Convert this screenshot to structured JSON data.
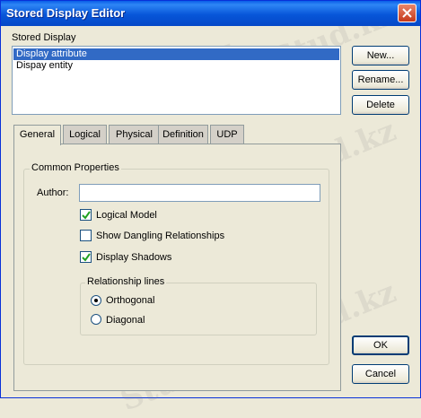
{
  "window": {
    "title": "Stored Display Editor"
  },
  "stored_display": {
    "label": "Stored Display",
    "items": [
      {
        "label": "Display attribute",
        "selected": true
      },
      {
        "label": "Dispay entity",
        "selected": false
      }
    ]
  },
  "buttons": {
    "new": "New...",
    "rename": "Rename...",
    "delete": "Delete",
    "ok": "OK",
    "cancel": "Cancel"
  },
  "tabs": [
    {
      "label": "General",
      "active": true
    },
    {
      "label": "Logical"
    },
    {
      "label": "Physical"
    },
    {
      "label": "Definition"
    },
    {
      "label": "UDP"
    }
  ],
  "common_properties": {
    "legend": "Common Properties",
    "author_label": "Author:",
    "author_value": "",
    "checkboxes": [
      {
        "label": "Logical Model",
        "checked": true
      },
      {
        "label": "Show Dangling Relationships",
        "checked": false
      },
      {
        "label": "Display Shadows",
        "checked": true
      }
    ]
  },
  "relationship_lines": {
    "legend": "Relationship lines",
    "options": [
      {
        "label": "Orthogonal",
        "selected": true
      },
      {
        "label": "Diagonal",
        "selected": false
      }
    ]
  },
  "watermark": {
    "text": "Stud.kz"
  }
}
